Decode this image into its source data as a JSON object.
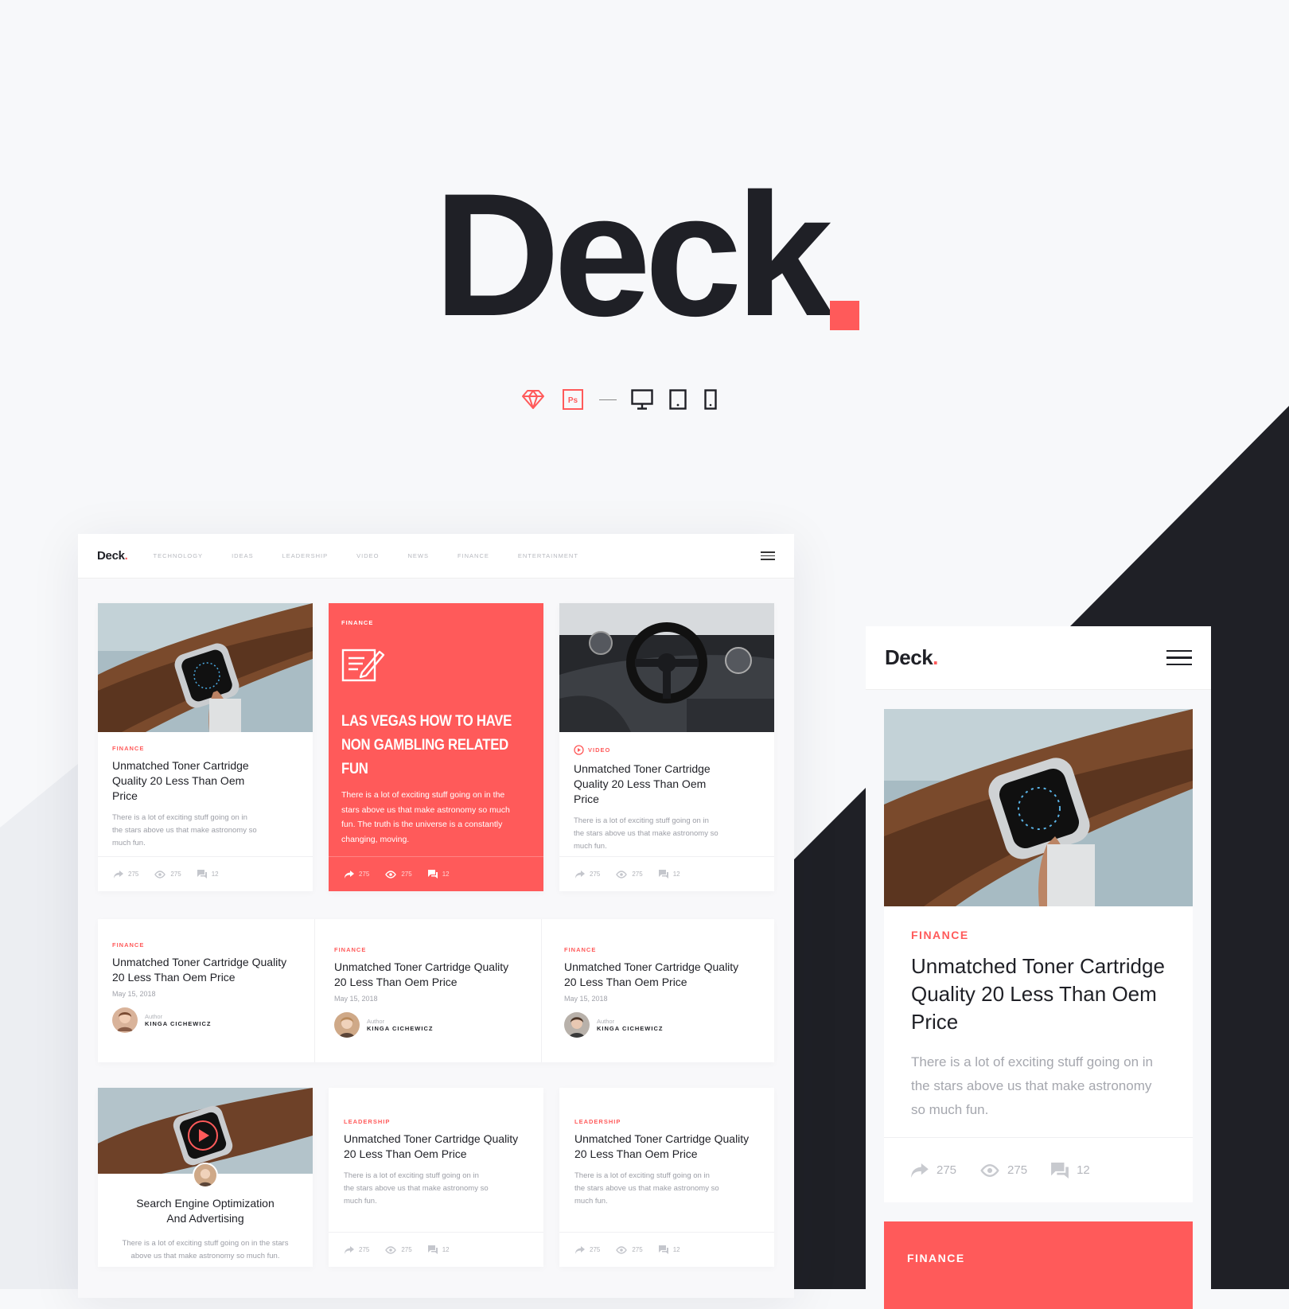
{
  "brand": {
    "name": "Deck",
    "accent": "#ff5a5a",
    "dark": "#1f2026"
  },
  "tools": [
    "sketch-icon",
    "photoshop-icon",
    "desktop-icon",
    "tablet-icon",
    "phone-icon"
  ],
  "tool_ps_label": "Ps",
  "desktop": {
    "logo": "Deck",
    "nav": [
      "TECHNOLOGY",
      "IDEAS",
      "LEADERSHIP",
      "VIDEO",
      "NEWS",
      "FINANCE",
      "ENTERTAINMENT"
    ],
    "row1": [
      {
        "category": "FINANCE",
        "title": "Unmatched Toner Cartridge Quality 20 Less Than Oem Price",
        "excerpt": "There is a lot of exciting stuff going on in the stars above us that make astronomy so much fun.",
        "shares": "275",
        "views": "275",
        "comments": "12"
      },
      {
        "category": "FINANCE",
        "title": "LAS VEGAS HOW TO HAVE NON GAMBLING RELATED FUN",
        "excerpt": "There is a lot of exciting stuff going on in the stars above us that make astronomy so much fun. The truth is the universe is a constantly changing, moving.",
        "shares": "275",
        "views": "275",
        "comments": "12"
      },
      {
        "category": "VIDEO",
        "title": "Unmatched Toner Cartridge Quality 20 Less Than Oem Price",
        "excerpt": "There is a lot of exciting stuff going on in the stars above us that make astronomy so much fun.",
        "shares": "275",
        "views": "275",
        "comments": "12"
      }
    ],
    "row2": [
      {
        "category": "FINANCE",
        "title": "Unmatched Toner Cartridge Quality 20 Less Than Oem Price",
        "date": "May 15, 2018",
        "author_label": "Author",
        "author": "KINGA CICHEWICZ"
      },
      {
        "category": "FINANCE",
        "title": "Unmatched Toner Cartridge Quality 20 Less Than Oem Price",
        "date": "May 15, 2018",
        "author_label": "Author",
        "author": "KINGA CICHEWICZ"
      },
      {
        "category": "FINANCE",
        "title": "Unmatched Toner Cartridge Quality 20 Less Than Oem Price",
        "date": "May 15, 2018",
        "author_label": "Author",
        "author": "KINGA CICHEWICZ"
      }
    ],
    "row3": [
      {
        "title": "Search Engine Optimization And Advertising",
        "excerpt": "There is a lot of exciting stuff going on in the stars above us that make astronomy so much fun."
      },
      {
        "category": "LEADERSHIP",
        "title": "Unmatched Toner Cartridge Quality 20 Less Than Oem Price",
        "excerpt": "There is a lot of exciting stuff going on in the stars above us that make astronomy so much fun.",
        "shares": "275",
        "views": "275",
        "comments": "12"
      },
      {
        "category": "LEADERSHIP",
        "title": "Unmatched Toner Cartridge Quality 20 Less Than Oem Price",
        "excerpt": "There is a lot of exciting stuff going on in the stars above us that make astronomy so much fun.",
        "shares": "275",
        "views": "275",
        "comments": "12"
      }
    ]
  },
  "mobile": {
    "logo": "Deck",
    "card": {
      "category": "FINANCE",
      "title": "Unmatched Toner Cartridge Quality 20 Less Than Oem Price",
      "excerpt": "There is a lot of exciting stuff going on in the stars above us that make astronomy so much fun.",
      "shares": "275",
      "views": "275",
      "comments": "12"
    },
    "next_category": "FINANCE"
  }
}
